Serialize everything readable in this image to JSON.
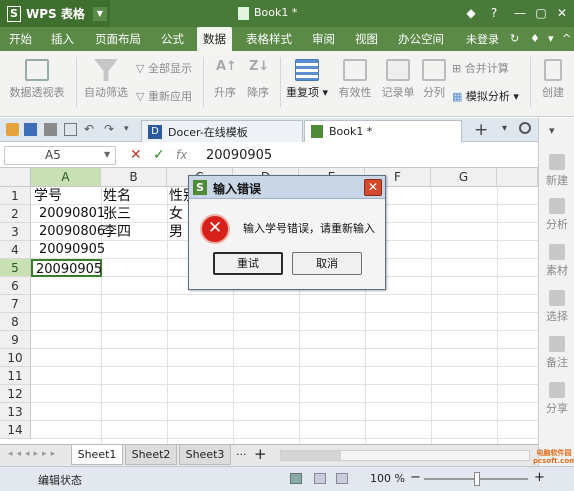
{
  "app": {
    "name": "WPS 表格",
    "doc_title": "Book1 *",
    "logo": "S"
  },
  "menu": {
    "tabs": [
      "开始",
      "插入",
      "页面布局",
      "公式",
      "数据",
      "表格样式",
      "审阅",
      "视图",
      "办公空间"
    ],
    "active": "数据",
    "login": "未登录"
  },
  "ribbon": {
    "pivot": "数据透视表",
    "autofilter": "自动筛选",
    "show_all": "全部显示",
    "reapply": "重新应用",
    "sort_asc": "升序",
    "sort_desc": "降序",
    "duplicates": "重复项",
    "validity": "有效性",
    "record": "记录单",
    "split": "分列",
    "merge_calc": "合并计算",
    "simulate": "模拟分析",
    "create": "创建"
  },
  "tabstrip": {
    "docer_tab": "Docer-在线模板",
    "book_tab": "Book1 *"
  },
  "formula": {
    "cell_ref": "A5",
    "fx": "fx",
    "value": "20090905"
  },
  "grid": {
    "columns": [
      "A",
      "B",
      "C",
      "D",
      "E",
      "F",
      "G"
    ],
    "rows": [
      "1",
      "2",
      "3",
      "4",
      "5",
      "6",
      "7",
      "8",
      "9",
      "10",
      "11",
      "12",
      "13",
      "14"
    ],
    "cells": {
      "a1": "学号",
      "b1": "姓名",
      "c1": "性别",
      "a2": "20090801",
      "b2": "张三",
      "c2": "女",
      "a3": "20090806",
      "b3": "李四",
      "c3": "男",
      "a4": "20090905",
      "a5": "20090905"
    }
  },
  "sheets": {
    "tabs": [
      "Sheet1",
      "Sheet2",
      "Sheet3"
    ],
    "more": "···",
    "add": "+"
  },
  "status": {
    "text": "编辑状态",
    "zoom": "100 %"
  },
  "rightpane": [
    "新建",
    "分析",
    "素材",
    "选择",
    "备注",
    "分享"
  ],
  "dialog": {
    "title": "输入错误",
    "message": "输入学号错误，请重新输入",
    "retry": "重试",
    "cancel": "取消",
    "close": "✕"
  },
  "watermark": "电脑软件园 pcsoft.com"
}
